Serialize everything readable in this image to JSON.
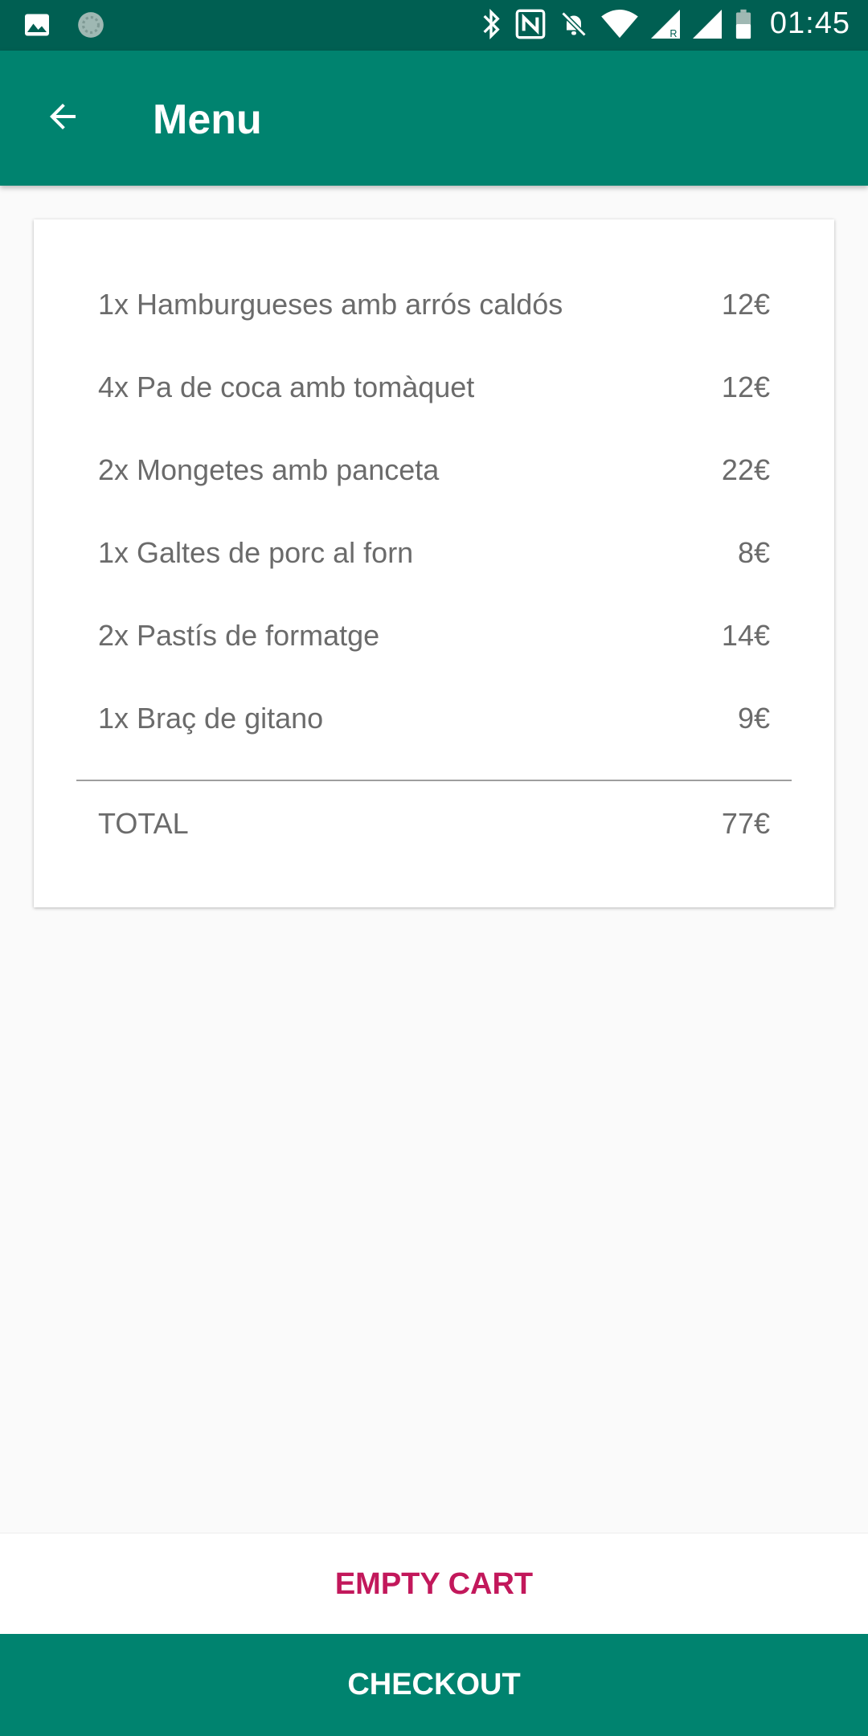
{
  "status_bar": {
    "time": "01:45",
    "icons": [
      "image-icon",
      "sync-icon",
      "bluetooth-icon",
      "nfc-icon",
      "notifications-off-icon",
      "wifi-icon",
      "signal-icon",
      "signal-icon",
      "battery-icon"
    ]
  },
  "app_bar": {
    "title": "Menu",
    "back_icon": "arrow-back-icon"
  },
  "cart": {
    "items": [
      {
        "name": "1x Hamburgueses amb arrós caldós",
        "price": "12€"
      },
      {
        "name": "4x Pa de coca amb tomàquet",
        "price": "12€"
      },
      {
        "name": "2x Mongetes amb panceta",
        "price": "22€"
      },
      {
        "name": "1x Galtes de porc al forn",
        "price": "8€"
      },
      {
        "name": "2x Pastís de formatge",
        "price": "14€"
      },
      {
        "name": "1x Braç de gitano",
        "price": "9€"
      }
    ],
    "total_label": "TOTAL",
    "total_value": "77€"
  },
  "actions": {
    "empty_cart": "EMPTY CART",
    "checkout": "CHECKOUT"
  },
  "colors": {
    "status_bar": "#005f52",
    "primary": "#00836f",
    "accent": "#c2185b",
    "text_secondary": "#6b6b6b"
  }
}
